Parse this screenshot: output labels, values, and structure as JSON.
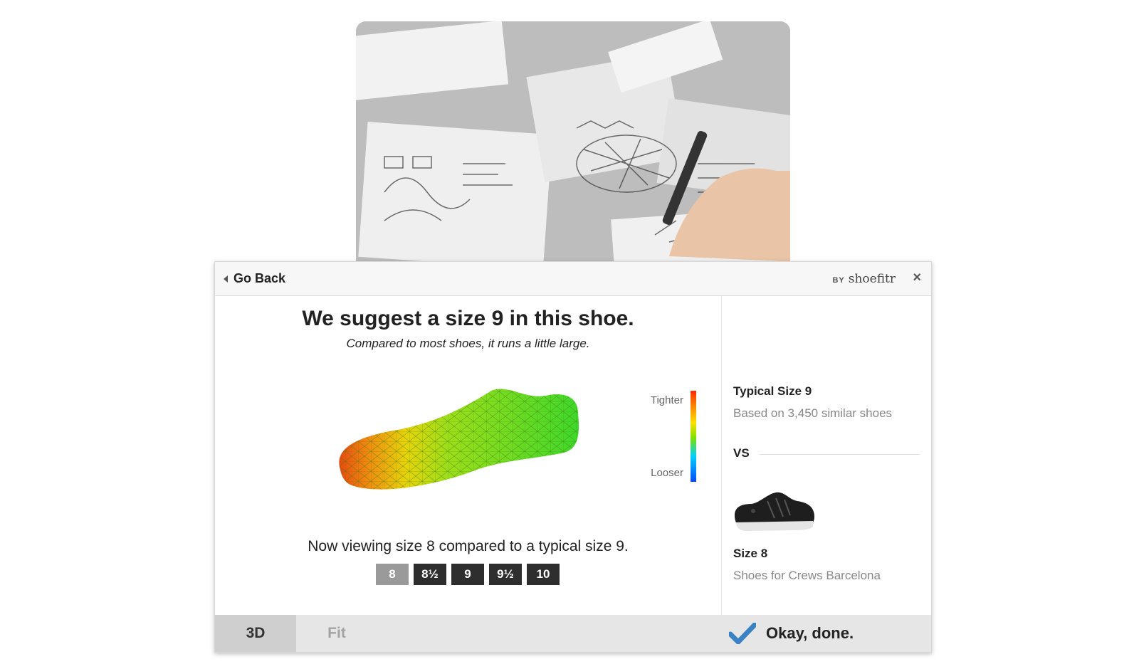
{
  "header": {
    "back_label": "Go Back",
    "by_label": "BY",
    "brand_name": "shoefitr",
    "close_symbol": "×"
  },
  "recommendation": {
    "headline": "We suggest a size 9 in this shoe.",
    "subline": "Compared to most shoes, it runs a little large."
  },
  "legend": {
    "top_label": "Tighter",
    "bottom_label": "Looser"
  },
  "viewer": {
    "viewing_text": "Now viewing size 8 compared to a typical size 9.",
    "sizes": [
      {
        "label": "8",
        "selected": true
      },
      {
        "label": "8½",
        "selected": false
      },
      {
        "label": "9",
        "selected": false
      },
      {
        "label": "9½",
        "selected": false
      },
      {
        "label": "10",
        "selected": false
      }
    ]
  },
  "comparison": {
    "typical_title": "Typical Size 9",
    "typical_sub": "Based on 3,450 similar shoes",
    "vs_label": "VS",
    "selected_title": "Size 8",
    "selected_sub": "Shoes for Crews Barcelona"
  },
  "footer": {
    "tab_3d": "3D",
    "tab_fit": "Fit",
    "done_label": "Okay, done."
  },
  "colors": {
    "accent_check": "#3a82c4",
    "size_button": "#2e2e2e",
    "size_button_selected": "#9a9a9a"
  }
}
